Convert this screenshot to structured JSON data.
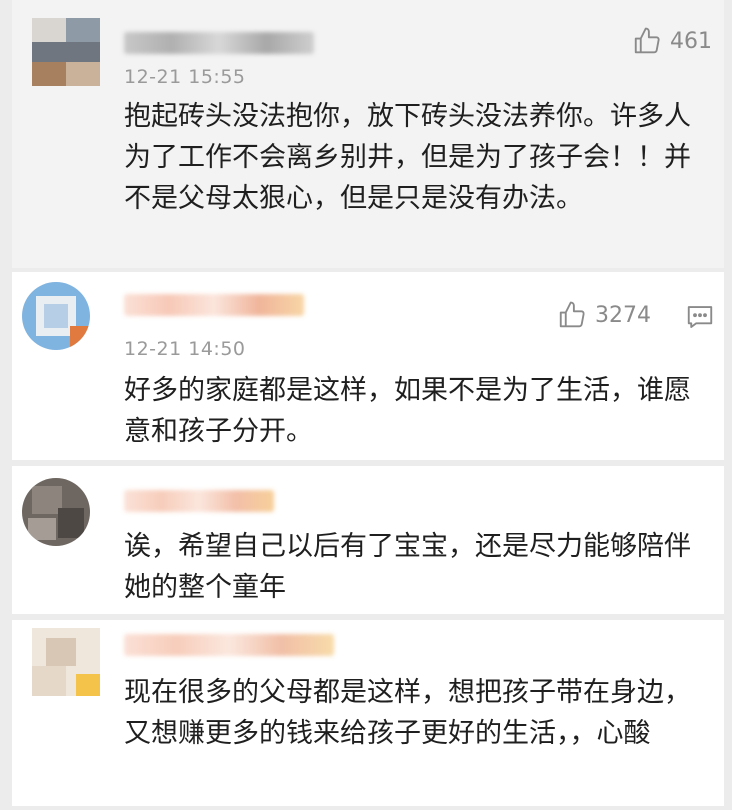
{
  "comments": [
    {
      "time": "12-21 15:55",
      "likes": "461",
      "text": "抱起砖头没法抱你，放下砖头没法养你。许多人为了工作不会离乡别井，但是为了孩子会！！并不是父母太狠心，但是只是没有办法。"
    },
    {
      "time": "12-21 14:50",
      "likes": "3274",
      "text": "好多的家庭都是这样，如果不是为了生活，谁愿意和孩子分开。"
    },
    {
      "text": "诶，希望自己以后有了宝宝，还是尽力能够陪伴她的整个童年"
    },
    {
      "text": "现在很多的父母都是这样，想把孩子带在身边，又想赚更多的钱来给孩子更好的生活，，心酸"
    }
  ],
  "icons": {
    "like": "thumbs-up-icon",
    "reply": "comment-icon"
  },
  "colors": {
    "background": "#ececec",
    "card": "#ffffff",
    "text": "#1f1f1f",
    "meta": "#9a9a9a",
    "icon": "#8a8a8a"
  }
}
